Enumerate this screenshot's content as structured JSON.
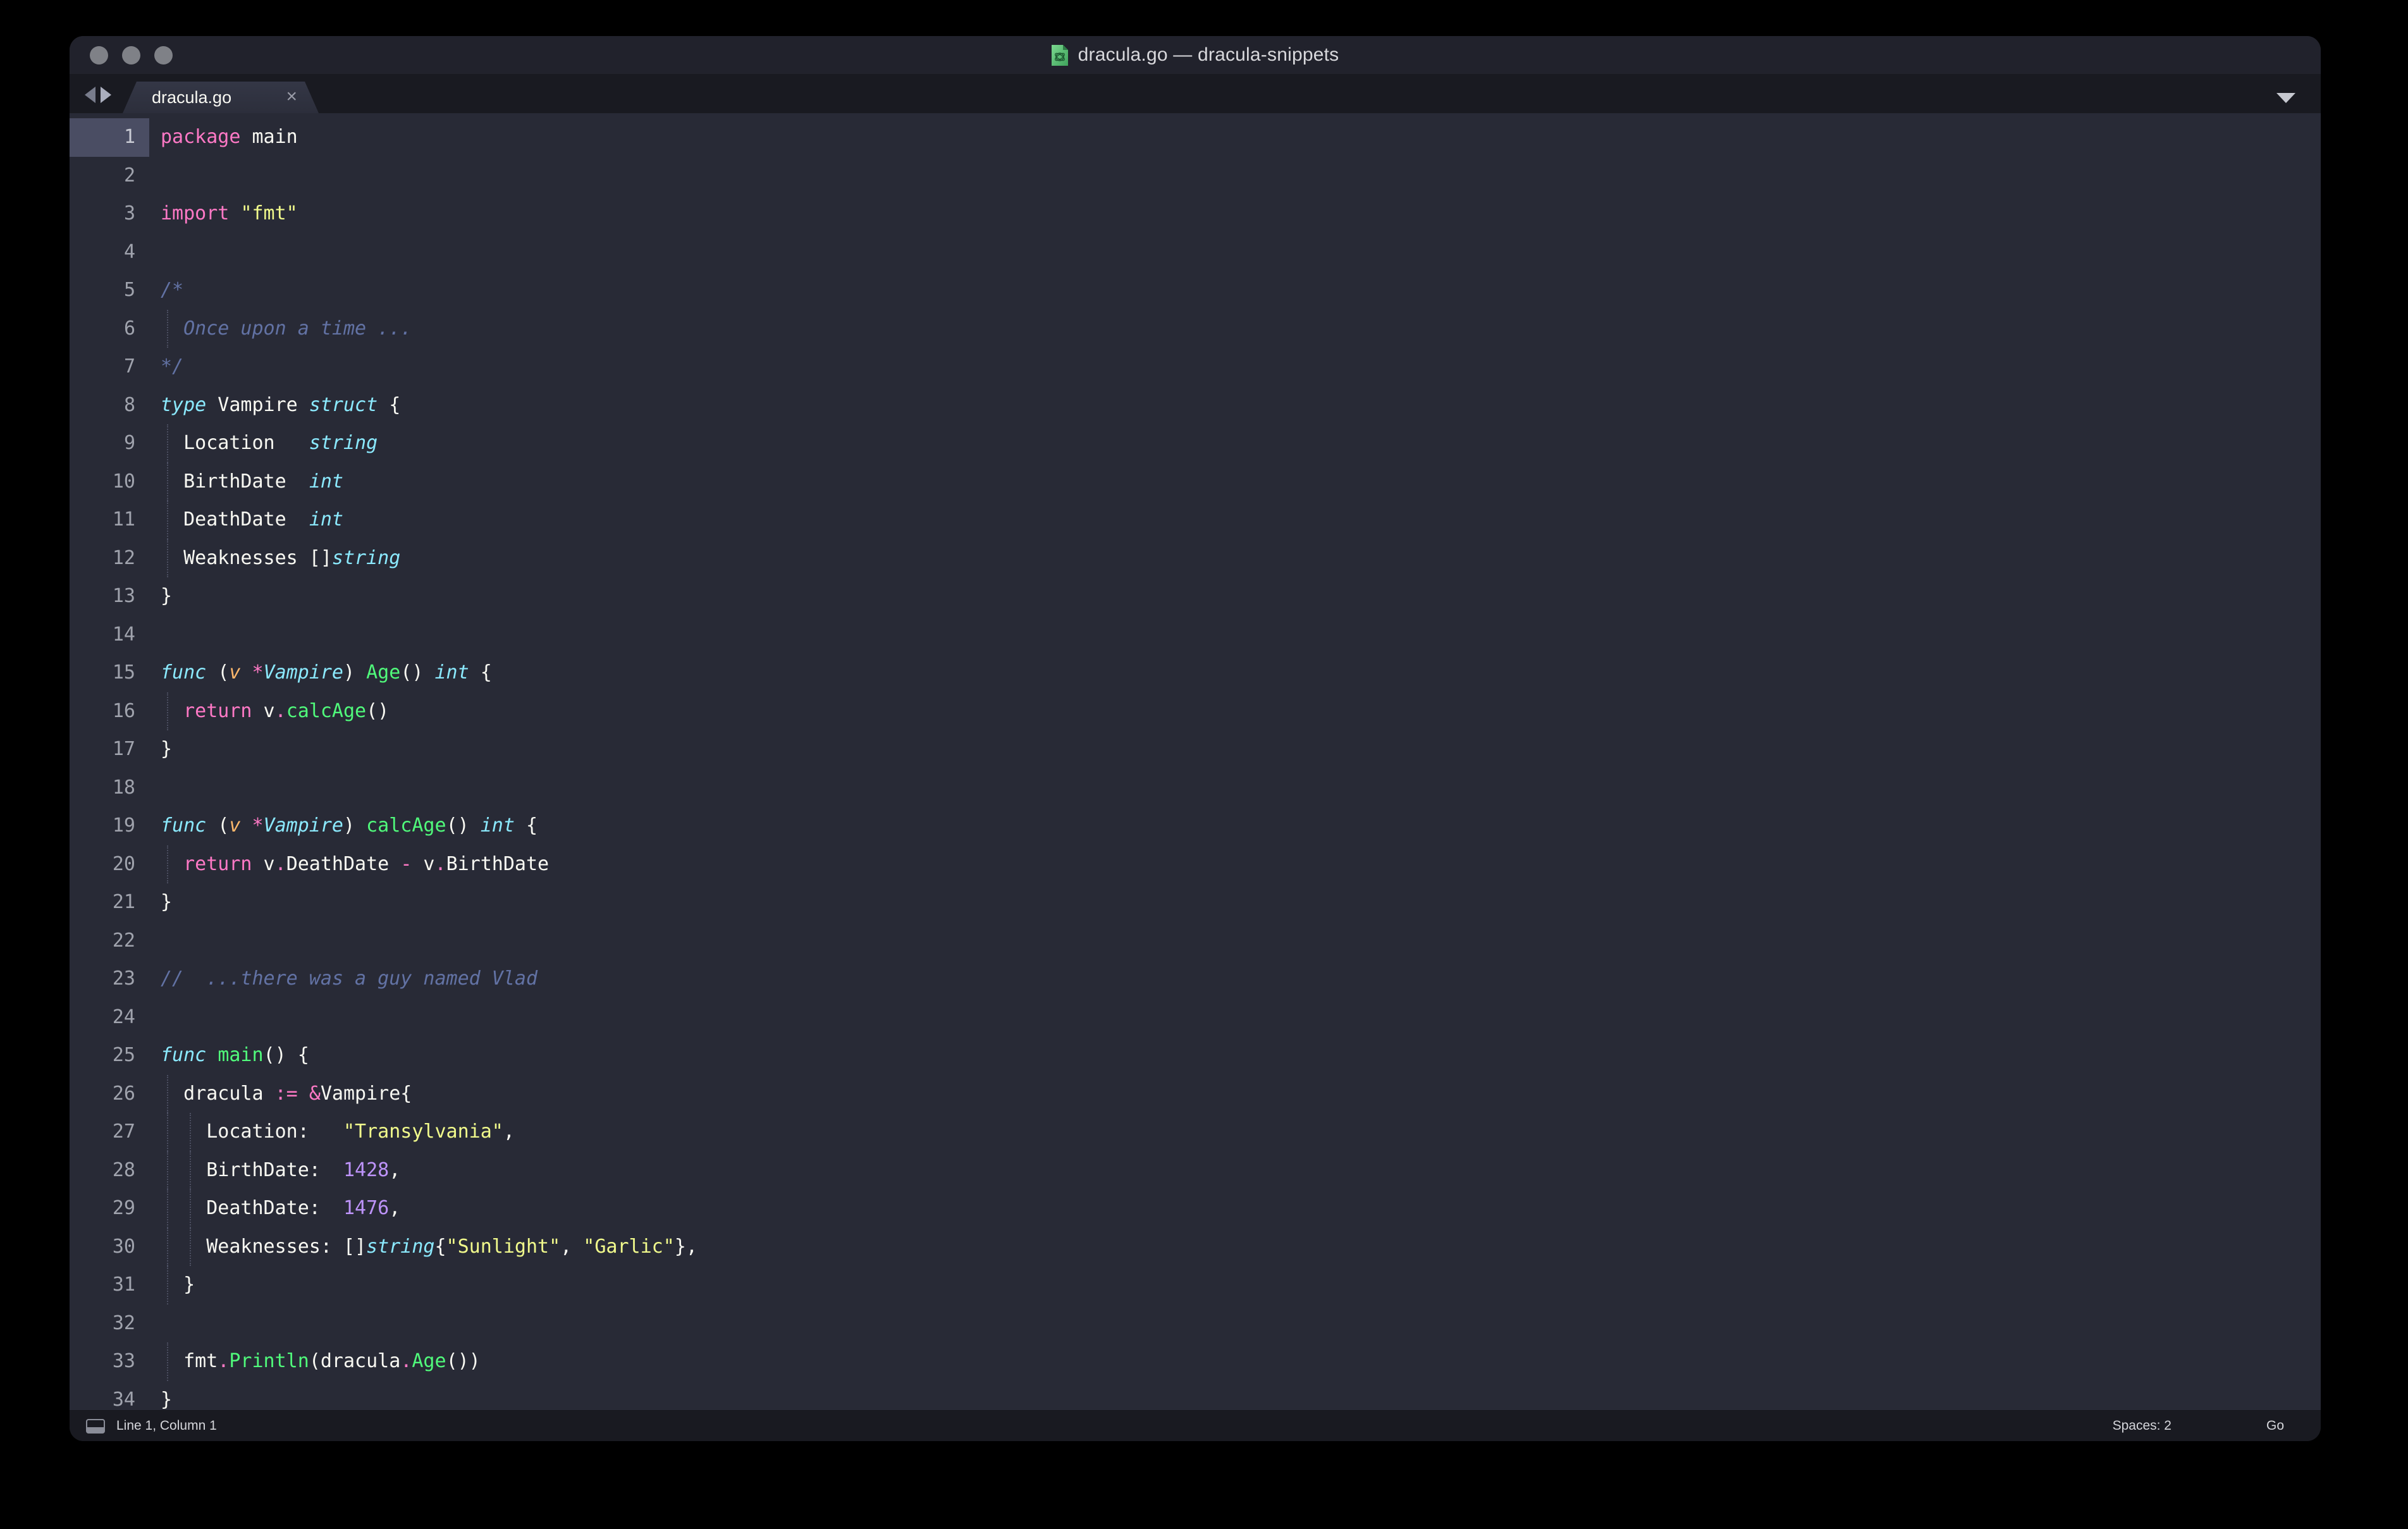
{
  "window": {
    "title": "dracula.go — dracula-snippets",
    "file_icon": "go-file-icon",
    "traffic_lights": [
      "close-button",
      "minimize-button",
      "zoom-button"
    ]
  },
  "tabbar": {
    "nav_back_icon": "nav-back-icon",
    "nav_forward_icon": "nav-forward-icon",
    "dropdown_icon": "chevron-down-icon",
    "tabs": [
      {
        "label": "dracula.go",
        "close_label": "×",
        "active": true
      }
    ]
  },
  "editor": {
    "active_line": 1,
    "line_count": 34,
    "line_numbers": [
      "1",
      "2",
      "3",
      "4",
      "5",
      "6",
      "7",
      "8",
      "9",
      "10",
      "11",
      "12",
      "13",
      "14",
      "15",
      "16",
      "17",
      "18",
      "19",
      "20",
      "21",
      "22",
      "23",
      "24",
      "25",
      "26",
      "27",
      "28",
      "29",
      "30",
      "31",
      "32",
      "33",
      "34"
    ],
    "lines": [
      {
        "n": 1,
        "indent": 0,
        "tokens": [
          {
            "t": "package",
            "c": "t-key"
          },
          {
            "t": " main",
            "c": "t-plain"
          }
        ]
      },
      {
        "n": 2,
        "indent": 0,
        "tokens": []
      },
      {
        "n": 3,
        "indent": 0,
        "tokens": [
          {
            "t": "import",
            "c": "t-key"
          },
          {
            "t": " ",
            "c": "t-plain"
          },
          {
            "t": "\"fmt\"",
            "c": "t-str"
          }
        ]
      },
      {
        "n": 4,
        "indent": 0,
        "tokens": []
      },
      {
        "n": 5,
        "indent": 0,
        "tokens": [
          {
            "t": "/*",
            "c": "t-com"
          }
        ]
      },
      {
        "n": 6,
        "indent": 1,
        "tokens": [
          {
            "t": "  Once upon a time ...",
            "c": "t-com"
          }
        ]
      },
      {
        "n": 7,
        "indent": 0,
        "tokens": [
          {
            "t": "*/",
            "c": "t-com"
          }
        ]
      },
      {
        "n": 8,
        "indent": 0,
        "tokens": [
          {
            "t": "type",
            "c": "t-kit"
          },
          {
            "t": " Vampire ",
            "c": "t-plain"
          },
          {
            "t": "struct",
            "c": "t-kit"
          },
          {
            "t": " {",
            "c": "t-plain"
          }
        ]
      },
      {
        "n": 9,
        "indent": 1,
        "tokens": [
          {
            "t": "  Location   ",
            "c": "t-plain"
          },
          {
            "t": "string",
            "c": "t-kit"
          }
        ]
      },
      {
        "n": 10,
        "indent": 1,
        "tokens": [
          {
            "t": "  BirthDate  ",
            "c": "t-plain"
          },
          {
            "t": "int",
            "c": "t-kit"
          }
        ]
      },
      {
        "n": 11,
        "indent": 1,
        "tokens": [
          {
            "t": "  DeathDate  ",
            "c": "t-plain"
          },
          {
            "t": "int",
            "c": "t-kit"
          }
        ]
      },
      {
        "n": 12,
        "indent": 1,
        "tokens": [
          {
            "t": "  Weaknesses []",
            "c": "t-plain"
          },
          {
            "t": "string",
            "c": "t-kit"
          }
        ]
      },
      {
        "n": 13,
        "indent": 0,
        "tokens": [
          {
            "t": "}",
            "c": "t-plain"
          }
        ]
      },
      {
        "n": 14,
        "indent": 0,
        "tokens": []
      },
      {
        "n": 15,
        "indent": 0,
        "tokens": [
          {
            "t": "func",
            "c": "t-kit"
          },
          {
            "t": " (",
            "c": "t-plain"
          },
          {
            "t": "v",
            "c": "t-par"
          },
          {
            "t": " ",
            "c": "t-plain"
          },
          {
            "t": "*",
            "c": "t-op"
          },
          {
            "t": "Vampire",
            "c": "t-kit"
          },
          {
            "t": ") ",
            "c": "t-plain"
          },
          {
            "t": "Age",
            "c": "t-fn"
          },
          {
            "t": "() ",
            "c": "t-plain"
          },
          {
            "t": "int",
            "c": "t-kit"
          },
          {
            "t": " {",
            "c": "t-plain"
          }
        ]
      },
      {
        "n": 16,
        "indent": 1,
        "tokens": [
          {
            "t": "  ",
            "c": "t-plain"
          },
          {
            "t": "return",
            "c": "t-key"
          },
          {
            "t": " v",
            "c": "t-plain"
          },
          {
            "t": ".",
            "c": "t-op"
          },
          {
            "t": "calcAge",
            "c": "t-fn"
          },
          {
            "t": "()",
            "c": "t-plain"
          }
        ]
      },
      {
        "n": 17,
        "indent": 0,
        "tokens": [
          {
            "t": "}",
            "c": "t-plain"
          }
        ]
      },
      {
        "n": 18,
        "indent": 0,
        "tokens": []
      },
      {
        "n": 19,
        "indent": 0,
        "tokens": [
          {
            "t": "func",
            "c": "t-kit"
          },
          {
            "t": " (",
            "c": "t-plain"
          },
          {
            "t": "v",
            "c": "t-par"
          },
          {
            "t": " ",
            "c": "t-plain"
          },
          {
            "t": "*",
            "c": "t-op"
          },
          {
            "t": "Vampire",
            "c": "t-kit"
          },
          {
            "t": ") ",
            "c": "t-plain"
          },
          {
            "t": "calcAge",
            "c": "t-fn"
          },
          {
            "t": "() ",
            "c": "t-plain"
          },
          {
            "t": "int",
            "c": "t-kit"
          },
          {
            "t": " {",
            "c": "t-plain"
          }
        ]
      },
      {
        "n": 20,
        "indent": 1,
        "tokens": [
          {
            "t": "  ",
            "c": "t-plain"
          },
          {
            "t": "return",
            "c": "t-key"
          },
          {
            "t": " v",
            "c": "t-plain"
          },
          {
            "t": ".",
            "c": "t-op"
          },
          {
            "t": "DeathDate ",
            "c": "t-plain"
          },
          {
            "t": "-",
            "c": "t-op"
          },
          {
            "t": " v",
            "c": "t-plain"
          },
          {
            "t": ".",
            "c": "t-op"
          },
          {
            "t": "BirthDate",
            "c": "t-plain"
          }
        ]
      },
      {
        "n": 21,
        "indent": 0,
        "tokens": [
          {
            "t": "}",
            "c": "t-plain"
          }
        ]
      },
      {
        "n": 22,
        "indent": 0,
        "tokens": []
      },
      {
        "n": 23,
        "indent": 0,
        "tokens": [
          {
            "t": "//  ...there was a guy named Vlad",
            "c": "t-com"
          }
        ]
      },
      {
        "n": 24,
        "indent": 0,
        "tokens": []
      },
      {
        "n": 25,
        "indent": 0,
        "tokens": [
          {
            "t": "func",
            "c": "t-kit"
          },
          {
            "t": " ",
            "c": "t-plain"
          },
          {
            "t": "main",
            "c": "t-fn"
          },
          {
            "t": "() {",
            "c": "t-plain"
          }
        ]
      },
      {
        "n": 26,
        "indent": 1,
        "tokens": [
          {
            "t": "  dracula ",
            "c": "t-plain"
          },
          {
            "t": ":=",
            "c": "t-op"
          },
          {
            "t": " ",
            "c": "t-plain"
          },
          {
            "t": "&",
            "c": "t-op"
          },
          {
            "t": "Vampire{",
            "c": "t-plain"
          }
        ]
      },
      {
        "n": 27,
        "indent": 2,
        "tokens": [
          {
            "t": "    Location:   ",
            "c": "t-plain"
          },
          {
            "t": "\"Transylvania\"",
            "c": "t-str"
          },
          {
            "t": ",",
            "c": "t-plain"
          }
        ]
      },
      {
        "n": 28,
        "indent": 2,
        "tokens": [
          {
            "t": "    BirthDate:  ",
            "c": "t-plain"
          },
          {
            "t": "1428",
            "c": "t-num"
          },
          {
            "t": ",",
            "c": "t-plain"
          }
        ]
      },
      {
        "n": 29,
        "indent": 2,
        "tokens": [
          {
            "t": "    DeathDate:  ",
            "c": "t-plain"
          },
          {
            "t": "1476",
            "c": "t-num"
          },
          {
            "t": ",",
            "c": "t-plain"
          }
        ]
      },
      {
        "n": 30,
        "indent": 2,
        "tokens": [
          {
            "t": "    Weaknesses: []",
            "c": "t-plain"
          },
          {
            "t": "string",
            "c": "t-kit"
          },
          {
            "t": "{",
            "c": "t-plain"
          },
          {
            "t": "\"Sunlight\"",
            "c": "t-str"
          },
          {
            "t": ", ",
            "c": "t-plain"
          },
          {
            "t": "\"Garlic\"",
            "c": "t-str"
          },
          {
            "t": "},",
            "c": "t-plain"
          }
        ]
      },
      {
        "n": 31,
        "indent": 1,
        "tokens": [
          {
            "t": "  }",
            "c": "t-plain"
          }
        ]
      },
      {
        "n": 32,
        "indent": 0,
        "tokens": []
      },
      {
        "n": 33,
        "indent": 1,
        "tokens": [
          {
            "t": "  fmt",
            "c": "t-plain"
          },
          {
            "t": ".",
            "c": "t-op"
          },
          {
            "t": "Println",
            "c": "t-fn"
          },
          {
            "t": "(dracula",
            "c": "t-plain"
          },
          {
            "t": ".",
            "c": "t-op"
          },
          {
            "t": "Age",
            "c": "t-fn"
          },
          {
            "t": "())",
            "c": "t-plain"
          }
        ]
      },
      {
        "n": 34,
        "indent": 0,
        "tokens": [
          {
            "t": "}",
            "c": "t-plain"
          }
        ]
      }
    ]
  },
  "statusbar": {
    "panel_icon": "console-panel-icon",
    "cursor_position": "Line 1, Column 1",
    "indentation": "Spaces: 2",
    "syntax": "Go"
  },
  "colors": {
    "background": "#000000",
    "window_chrome": "#21222C",
    "tabbar": "#191A21",
    "tab_active": "#343746",
    "editor_bg": "#282A36",
    "gutter_active": "#4A4D63",
    "foreground": "#F8F8F2",
    "comment": "#6272A4",
    "pink": "#FF79C6",
    "cyan": "#8BE9FD",
    "green": "#50FA7B",
    "orange": "#FFB86C",
    "purple": "#BD93F9",
    "yellow": "#F1FA8C"
  }
}
